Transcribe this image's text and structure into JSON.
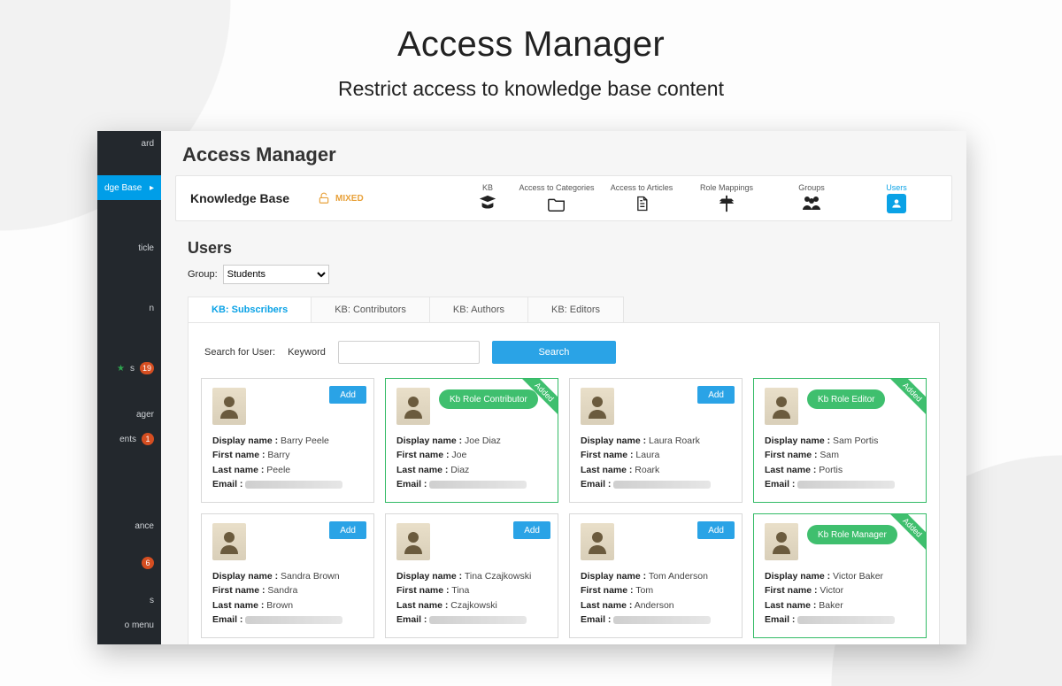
{
  "hero": {
    "title": "Access Manager",
    "subtitle": "Restrict access to knowledge base content"
  },
  "sidebar": {
    "items": [
      {
        "label": "ard"
      },
      {
        "label": "dge Base",
        "active": true
      },
      {
        "label": "ticle"
      },
      {
        "label": "n"
      },
      {
        "label": "s",
        "star": true,
        "badge": "19"
      },
      {
        "label": "ager"
      },
      {
        "label": "ents",
        "badge": "1"
      },
      {
        "label": "ance"
      },
      {
        "label": "",
        "badge": "6"
      },
      {
        "label": "s"
      },
      {
        "label": "o menu"
      }
    ]
  },
  "pageTitle": "Access Manager",
  "toolbar": {
    "brand": "Knowledge Base",
    "mixed": "MIXED",
    "items": [
      {
        "key": "kb",
        "label": "KB"
      },
      {
        "key": "cats",
        "label": "Access to Categories"
      },
      {
        "key": "arts",
        "label": "Access to Articles"
      },
      {
        "key": "roles",
        "label": "Role Mappings"
      },
      {
        "key": "groups",
        "label": "Groups"
      },
      {
        "key": "users",
        "label": "Users",
        "active": true
      }
    ]
  },
  "users": {
    "title": "Users",
    "groupLabel": "Group:",
    "groupSelected": "Students",
    "tabs": [
      "KB: Subscribers",
      "KB: Contributors",
      "KB: Authors",
      "KB: Editors"
    ],
    "activeTab": 0,
    "search": {
      "label": "Search for User:",
      "keyword": "Keyword",
      "button": "Search"
    },
    "addLabel": "Add",
    "ribbonLabel": "Added",
    "cards": [
      {
        "display": "Barry Peele",
        "first": "Barry",
        "last": "Peele",
        "add": true
      },
      {
        "display": "Joe Diaz",
        "first": "Joe",
        "last": "Diaz",
        "role": "Kb Role Contributor",
        "added": true
      },
      {
        "display": "Laura Roark",
        "first": "Laura",
        "last": "Roark",
        "add": true
      },
      {
        "display": "Sam Portis",
        "first": "Sam",
        "last": "Portis",
        "role": "Kb Role Editor",
        "added": true
      },
      {
        "display": "Sandra Brown",
        "first": "Sandra",
        "last": "Brown",
        "add": true
      },
      {
        "display": "Tina Czajkowski",
        "first": "Tina",
        "last": "Czajkowski",
        "add": true
      },
      {
        "display": "Tom Anderson",
        "first": "Tom",
        "last": "Anderson",
        "add": true
      },
      {
        "display": "Victor Baker",
        "first": "Victor",
        "last": "Baker",
        "role": "Kb Role Manager",
        "added": true
      }
    ],
    "metaLabels": {
      "display": "Display name",
      "first": "First name",
      "last": "Last name",
      "email": "Email"
    }
  }
}
